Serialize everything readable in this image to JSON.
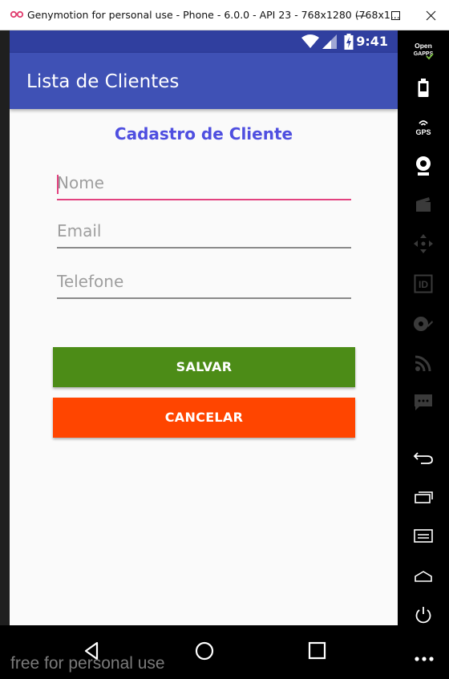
{
  "window": {
    "title": "Genymotion for personal use - Phone - 6.0.0 - API 23 - 768x1280 (768x1..."
  },
  "status_bar": {
    "time": "9:41"
  },
  "app_bar": {
    "title": "Lista de Clientes"
  },
  "form": {
    "title": "Cadastro de Cliente",
    "fields": [
      {
        "placeholder": "Nome",
        "value": ""
      },
      {
        "placeholder": "Email",
        "value": ""
      },
      {
        "placeholder": "Telefone",
        "value": ""
      }
    ],
    "save_label": "SALVAR",
    "cancel_label": "CANCELAR"
  },
  "side_panel": {
    "opengapps_label": "Open GAPPS",
    "gps_label": "GPS",
    "id_label": "ID"
  },
  "watermark": "free for personal use",
  "colors": {
    "status_bar": "#303f9f",
    "app_bar": "#3f51b5",
    "accent": "#e2427f",
    "form_title": "#4f4fe0",
    "save_button": "#4c8c17",
    "cancel_button": "#ff4500"
  }
}
